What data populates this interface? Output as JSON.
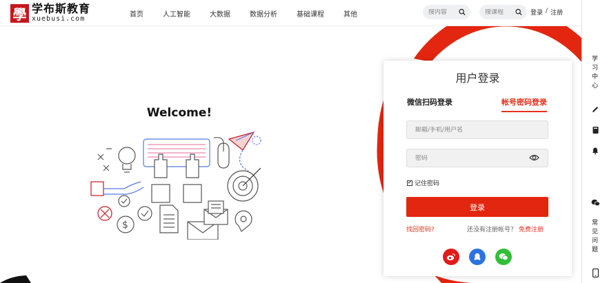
{
  "brand": {
    "seal": "學",
    "name_cn": "学布斯教育",
    "name_en": "xuebusi.com",
    "color": "#c8161d"
  },
  "nav": {
    "items": [
      "首页",
      "人工智能",
      "大数据",
      "数据分析",
      "基础课程",
      "其他"
    ]
  },
  "search": {
    "content_placeholder": "搜内容",
    "course_placeholder": "搜课程"
  },
  "auth": {
    "login": "登录",
    "sep": "/",
    "register": "注册"
  },
  "sidebar": {
    "study_center": "学习中心",
    "faq": "常见问题",
    "icons": [
      "pencil-icon",
      "book-icon",
      "bell-icon",
      "wechat-icon",
      "phone-icon"
    ]
  },
  "welcome": {
    "title": "Welcome!"
  },
  "login": {
    "title": "用户登录",
    "tab_wechat": "微信扫码登录",
    "tab_account": "帐号密码登录",
    "user_placeholder": "邮箱/手机/用户名",
    "pass_placeholder": "密码",
    "remember": "记住密码",
    "remember_checked": true,
    "submit": "登录",
    "forgot": "找回密码?",
    "no_account": "还没有注册帐号？",
    "register": "免费注册",
    "accent": "#e3260f",
    "social": {
      "weibo": "weibo-icon",
      "qq": "qq-icon",
      "wechat": "wechat-icon",
      "weibo_color": "#e21a1a",
      "qq_color": "#2b73e0",
      "wechat_color": "#31bf38"
    }
  }
}
